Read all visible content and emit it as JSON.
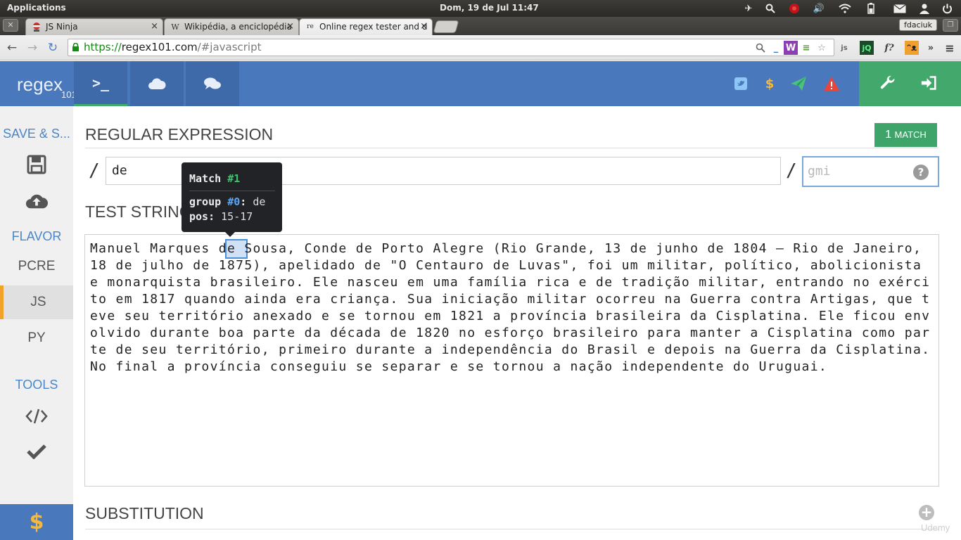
{
  "os": {
    "apps_label": "Applications",
    "clock": "Dom, 19 de Jul 11:47"
  },
  "browser": {
    "tabs": [
      {
        "favicon": "ninja-icon",
        "title": "JS Ninja"
      },
      {
        "favicon": "wikipedia-icon",
        "title": "Wikipédia, a enciclopédia"
      },
      {
        "favicon": "regex101-icon",
        "title": "Online regex tester and d"
      }
    ],
    "profile_name": "fdaciuk",
    "url": {
      "scheme": "https://",
      "host": "regex101.com",
      "path": "/#javascript"
    }
  },
  "app": {
    "logo_main": "regex",
    "logo_sub": "101"
  },
  "sidebar": {
    "save_heading": "SAVE & S...",
    "flavor_heading": "FLAVOR",
    "flavors": [
      "PCRE",
      "JS",
      "PY"
    ],
    "active_flavor": "JS",
    "tools_heading": "TOOLS"
  },
  "main": {
    "regex_heading": "REGULAR EXPRESSION",
    "match_count": "1",
    "match_label": "MATCH",
    "regex_delim_open": "/",
    "regex_value": "de",
    "regex_delim_close": "/",
    "flags_placeholder": "gmi",
    "flags_help": "?",
    "test_heading": "TEST STRING",
    "test_string": "Manuel Marques de Sousa, Conde de Porto Alegre (Rio Grande, 13 de junho de 1804 – Rio de Janeiro, 18 de julho de 1875), apelidado de \"O Centauro de Luvas\", foi um militar, político, abolicionista e monarquista brasileiro. Ele nasceu em uma família rica e de tradição militar, entrando no exército em 1817 quando ainda era criança. Sua iniciação militar ocorreu na Guerra contra Artigas, que teve seu território anexado e se tornou em 1821 a província brasileira da Cisplatina. Ele ficou envolvido durante boa parte da década de 1820 no esforço brasileiro para manter a Cisplatina como parte de seu território, primeiro durante a independência do Brasil e depois na Guerra da Cisplatina. No final a província conseguiu se separar e se tornou a nação independente do Uruguai.",
    "substitution_heading": "SUBSTITUTION"
  },
  "tooltip": {
    "title": "Match",
    "match_number": "#1",
    "group_label": "group",
    "group_id": "#0",
    "group_value": "de",
    "pos_label": "pos:",
    "pos_value": "15-17"
  },
  "watermark": "Udemy",
  "colors": {
    "header_blue": "#4a78bd",
    "header_green": "#43a86b",
    "match_green": "#3fa46a",
    "flavor_accent": "#f0a22a",
    "sidebar_heading_blue": "#4a86c8"
  }
}
